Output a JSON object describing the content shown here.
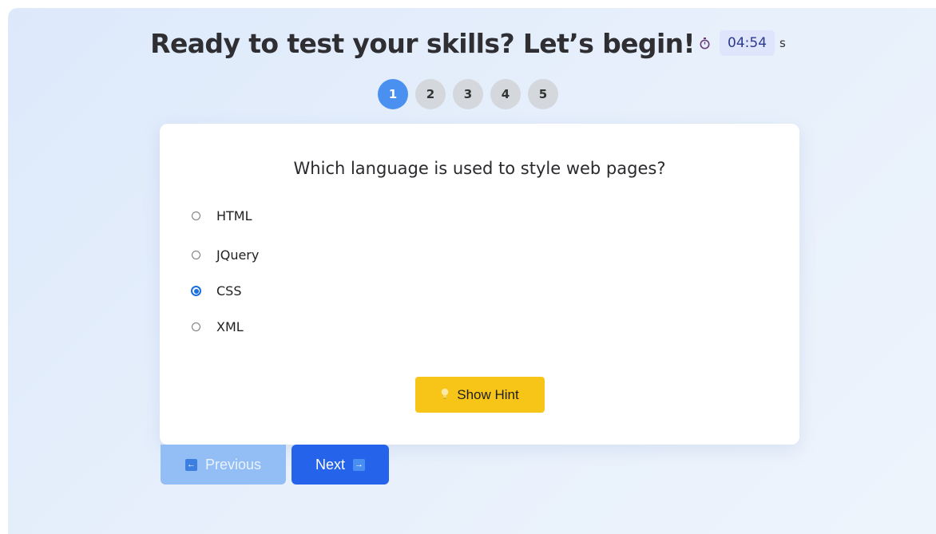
{
  "header": {
    "title": "Ready to test your skills? Let’s begin!",
    "timer_icon": "stopwatch-icon",
    "timer_value": "04:54",
    "timer_unit": "s"
  },
  "steps": [
    "1",
    "2",
    "3",
    "4",
    "5"
  ],
  "active_step": "1",
  "quiz": {
    "question": "Which language is used to style web pages?",
    "options": [
      "HTML",
      "JQuery",
      "CSS",
      "XML"
    ],
    "selected": "CSS"
  },
  "hint": {
    "label": "Show Hint",
    "icon": "lightbulb-icon"
  },
  "navigation": {
    "previous_label": "Previous",
    "next_label": "Next",
    "previous_icon": "left-arrow-icon",
    "next_icon": "right-arrow-icon"
  },
  "colors": {
    "active_step": "#4a90f0",
    "hint_button": "#f7c517",
    "next_button": "#2563eb",
    "previous_button_disabled": "#93bdf5",
    "radio_checked": "#1a6fe0"
  }
}
